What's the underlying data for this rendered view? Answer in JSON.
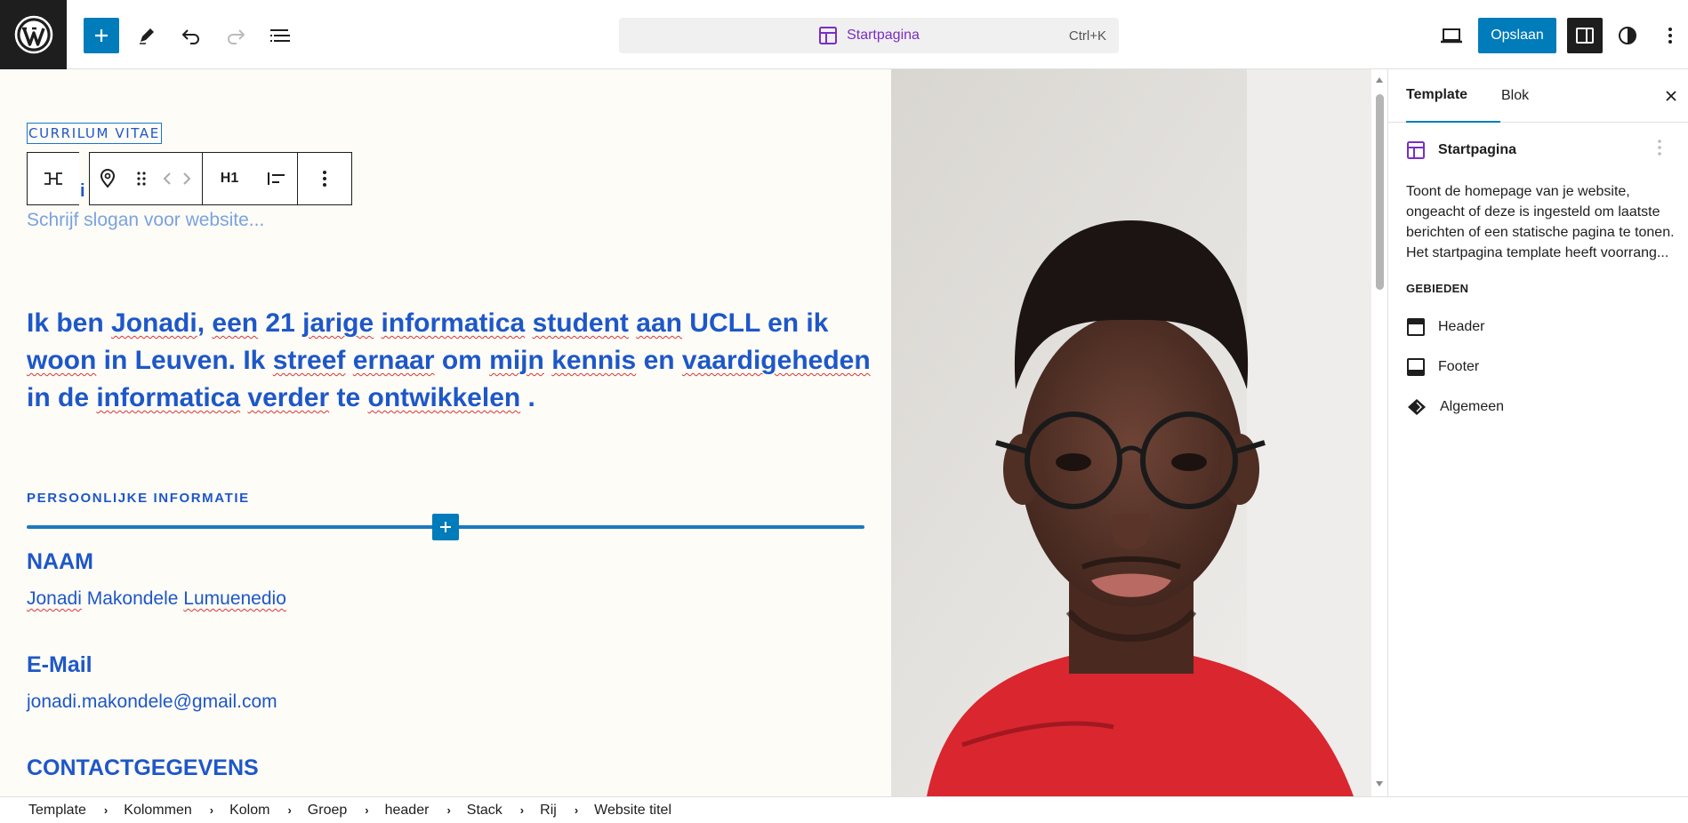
{
  "toolbar": {
    "command_title": "Startpagina",
    "shortcut": "Ctrl+K",
    "save_label": "Opslaan"
  },
  "canvas": {
    "site_title": "CURRILUM VITAE",
    "heading_level": "H1",
    "heading_partial": "i",
    "slogan_placeholder": "Schrijf slogan voor website...",
    "intro": {
      "t0": "Ik ben ",
      "w1": "Jonadi",
      "t1": ", ",
      "w2": "een",
      "t2": " 21 ",
      "w3": "jarige",
      "t3": " ",
      "w4": "informatica",
      "t4": " ",
      "w5": "student",
      "t5": " ",
      "w6": "aan",
      "t6": " UCLL en ik ",
      "w7": "woon",
      "t7": " in Leuven. Ik ",
      "w8": "streef",
      "t8": " ",
      "w9": "ernaar",
      "t9": " om ",
      "w10": "mijn",
      "t10": " ",
      "w11": "kennis",
      "t11": " en ",
      "w12": "vaardigeheden",
      "t12": " in de ",
      "w13": "informatica",
      "t13": " ",
      "w14": "verder",
      "t14": " te ",
      "w15": "ontwikkelen",
      "t15": " ."
    },
    "section_label": "PERSOONLIJKE INFORMATIE",
    "name_heading": "NAAM",
    "name_value_1": "Jonadi",
    "name_value_2": " Makondele ",
    "name_value_3": "Lumuenedio",
    "email_heading": "E-Mail",
    "email_value": "jonadi.makondele@gmail.com",
    "contact_heading": "CONTACTGEGEVENS"
  },
  "sidebar": {
    "tabs": [
      "Template",
      "Blok"
    ],
    "template_name": "Startpagina",
    "description": "Toont de homepage van je website, ongeacht of deze is ingesteld om laatste berichten of een statische pagina te tonen. Het startpagina template heeft voorrang...",
    "areas_label": "GEBIEDEN",
    "areas": [
      "Header",
      "Footer",
      "Algemeen"
    ]
  },
  "breadcrumb": [
    "Template",
    "Kolommen",
    "Kolom",
    "Groep",
    "header",
    "Stack",
    "Rij",
    "Website titel"
  ],
  "colors": {
    "accent": "#007cba",
    "heading_blue": "#1e57c8",
    "template_purple": "#7a2ec4"
  }
}
